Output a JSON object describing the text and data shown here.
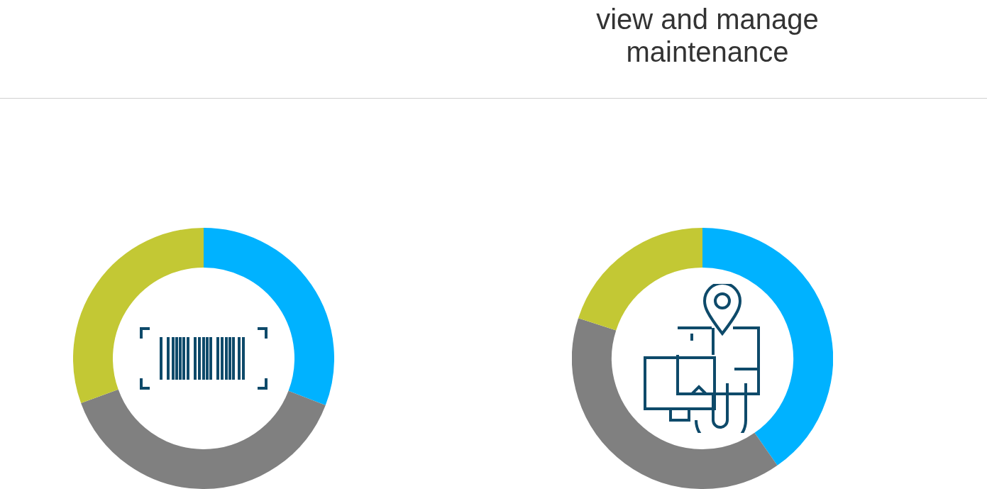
{
  "header": {
    "text": "view and manage maintenance"
  }
}
